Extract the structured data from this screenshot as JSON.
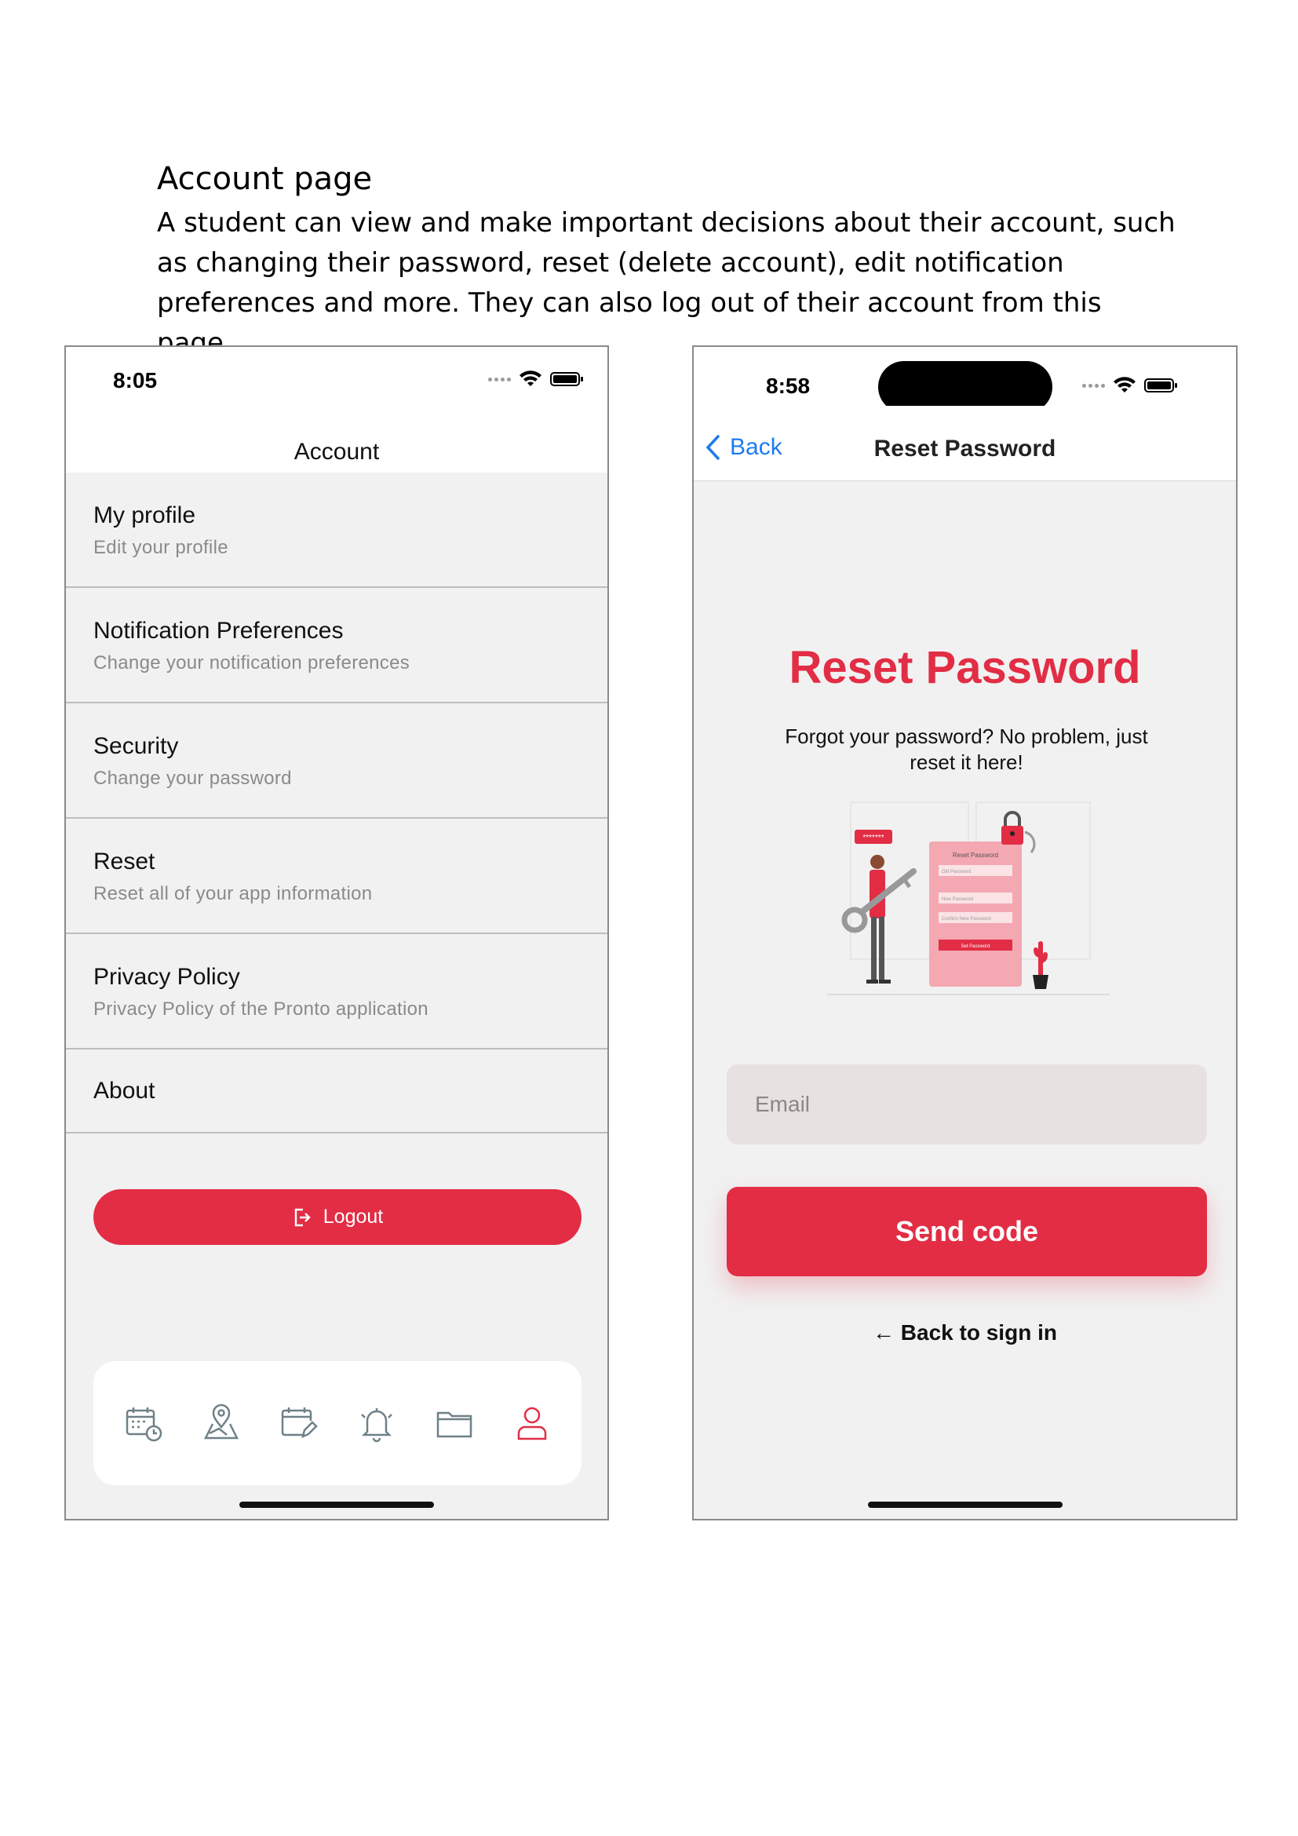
{
  "document": {
    "title": "Account page",
    "description": "A student can view and make important decisions about their account, such as changing their password, reset (delete account), edit notification preferences and more. They can also log out of their account from this page."
  },
  "account_screen": {
    "status_time": "8:05",
    "header_title": "Account",
    "menu": [
      {
        "title": "My profile",
        "subtitle": "Edit your profile"
      },
      {
        "title": "Notification Preferences",
        "subtitle": "Change your notification preferences"
      },
      {
        "title": "Security",
        "subtitle": "Change your password"
      },
      {
        "title": "Reset",
        "subtitle": "Reset all of your app information"
      },
      {
        "title": "Privacy Policy",
        "subtitle": "Privacy Policy of the Pronto application"
      },
      {
        "title": "About"
      }
    ],
    "logout_label": "Logout",
    "tabs": [
      "calendar-clock-icon",
      "map-pin-icon",
      "calendar-edit-icon",
      "bell-icon",
      "folder-icon",
      "user-icon"
    ],
    "active_tab": "user-icon"
  },
  "reset_screen": {
    "status_time": "8:58",
    "back_label": "Back",
    "header_title": "Reset Password",
    "heading": "Reset Password",
    "subtitle": "Forgot your password? No problem, just reset it here!",
    "illustration": {
      "form_title": "Reset Password",
      "field_old": "Old Password",
      "field_new": "New Password",
      "field_confirm": "Confirm New Password",
      "button": "Set Password",
      "speech": "*******"
    },
    "email_placeholder": "Email",
    "send_label": "Send code",
    "back_signin_label": "← Back to sign in"
  },
  "colors": {
    "accent": "#e22d45",
    "link": "#1d7bf2",
    "screen_bg": "#f1f1f1",
    "icon_gray": "#6f8088"
  }
}
